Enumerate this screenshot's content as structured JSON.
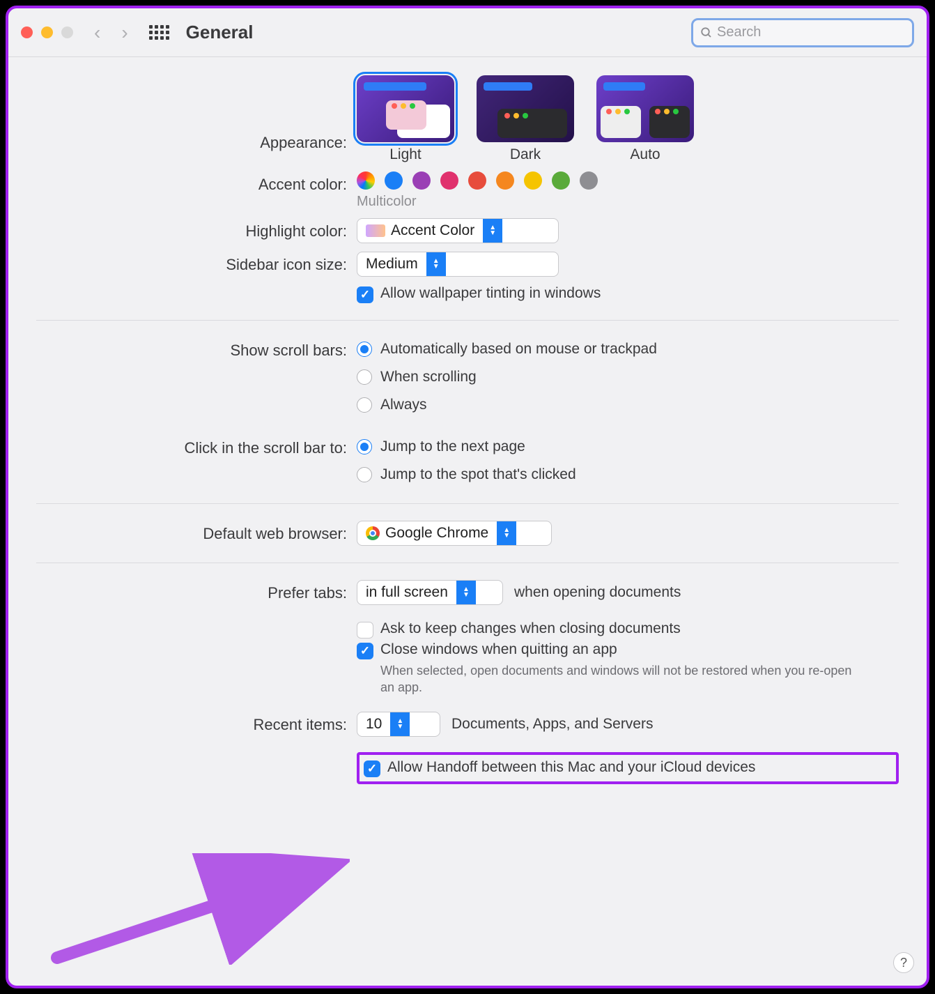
{
  "toolbar": {
    "title": "General",
    "search_placeholder": "Search"
  },
  "appearance": {
    "label": "Appearance:",
    "options": [
      "Light",
      "Dark",
      "Auto"
    ],
    "selected": "Light"
  },
  "accent": {
    "label": "Accent color:",
    "caption": "Multicolor",
    "colors": [
      "multi",
      "#1a7ff6",
      "#9a3fb5",
      "#e0316d",
      "#e74c3c",
      "#f5871f",
      "#f5c400",
      "#5aaa3a",
      "#8e8e92"
    ]
  },
  "highlight": {
    "label": "Highlight color:",
    "value": "Accent Color"
  },
  "sidebar_size": {
    "label": "Sidebar icon size:",
    "value": "Medium"
  },
  "wallpaper_tint": {
    "label": "Allow wallpaper tinting in windows",
    "checked": true
  },
  "scrollbars": {
    "label": "Show scroll bars:",
    "options": [
      "Automatically based on mouse or trackpad",
      "When scrolling",
      "Always"
    ],
    "selected": 0
  },
  "scroll_click": {
    "label": "Click in the scroll bar to:",
    "options": [
      "Jump to the next page",
      "Jump to the spot that's clicked"
    ],
    "selected": 0
  },
  "browser": {
    "label": "Default web browser:",
    "value": "Google Chrome"
  },
  "tabs": {
    "label": "Prefer tabs:",
    "value": "in full screen",
    "suffix": "when opening documents"
  },
  "ask_changes": {
    "label": "Ask to keep changes when closing documents",
    "checked": false
  },
  "close_windows": {
    "label": "Close windows when quitting an app",
    "checked": true,
    "note": "When selected, open documents and windows will not be restored when you re-open an app."
  },
  "recent": {
    "label": "Recent items:",
    "value": "10",
    "suffix": "Documents, Apps, and Servers"
  },
  "handoff": {
    "label": "Allow Handoff between this Mac and your iCloud devices",
    "checked": true
  },
  "help": "?"
}
